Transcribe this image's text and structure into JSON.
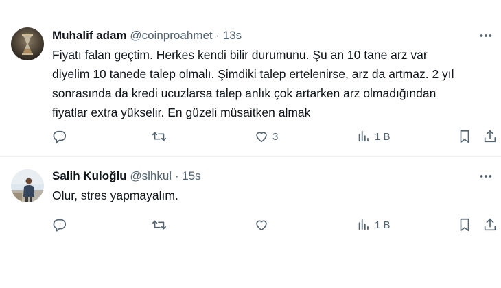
{
  "tweets": [
    {
      "author_name": "Muhalif adam",
      "handle": "@coinproahmet",
      "separator": "·",
      "time": "13s",
      "text_lines": [
        "Fiyatı falan geçtim. Herkes kendi bilir durumunu. Şu an 10 tane arz var",
        "diyelim 10 tanede talep olmalı. Şimdiki talep ertelenirse, arz da artmaz. 2 yıl",
        "sonrasında da kredi ucuzlarsa talep anlık çok artarken arz olmadığından",
        "fiyatlar extra yükselir. En güzeli müsaitken almak"
      ],
      "like_count": "3",
      "views_count": "1 B",
      "avatar_icon": "hourglass-avatar"
    },
    {
      "author_name": "Salih Kuloğlu",
      "handle": "@slhkul",
      "separator": "·",
      "time": "15s",
      "text_lines": [
        "Olur, stres yapmayalım."
      ],
      "like_count": "",
      "views_count": "1 B",
      "avatar_icon": "person-photo-avatar"
    }
  ],
  "icons": [
    "reply-icon",
    "retweet-icon",
    "like-icon",
    "views-icon",
    "bookmark-icon",
    "share-icon",
    "more-icon"
  ],
  "colors": {
    "text": "#0f1419",
    "secondary": "#536471",
    "border": "#eff3f4"
  }
}
